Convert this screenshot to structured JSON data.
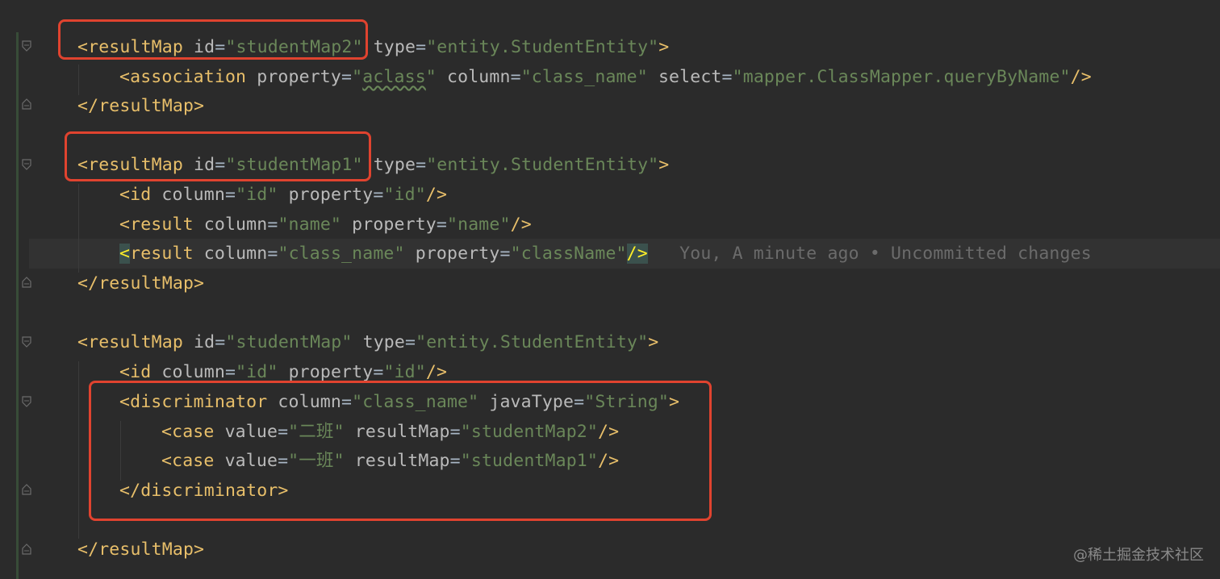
{
  "editor": {
    "lines": [
      {
        "parts": [
          [
            "t",
            "<resultMap "
          ],
          [
            "a",
            "id"
          ],
          [
            "p",
            "="
          ],
          [
            "v",
            "\"studentMap2\""
          ],
          [
            "p",
            " "
          ],
          [
            "a",
            "type"
          ],
          [
            "p",
            "="
          ],
          [
            "v",
            "\"entity.StudentEntity\""
          ],
          [
            "t",
            ">"
          ]
        ]
      },
      {
        "parts": [
          [
            "t",
            "<association "
          ],
          [
            "a",
            "property"
          ],
          [
            "p",
            "="
          ],
          [
            "v",
            "\""
          ],
          [
            "vs",
            "aclass"
          ],
          [
            "v",
            "\""
          ],
          [
            "p",
            " "
          ],
          [
            "a",
            "column"
          ],
          [
            "p",
            "="
          ],
          [
            "v",
            "\"class_name\""
          ],
          [
            "p",
            " "
          ],
          [
            "a",
            "select"
          ],
          [
            "p",
            "="
          ],
          [
            "v",
            "\"mapper.ClassMapper.queryByName\""
          ],
          [
            "t",
            "/>"
          ]
        ]
      },
      {
        "parts": [
          [
            "t",
            "</resultMap>"
          ]
        ]
      },
      {
        "parts": []
      },
      {
        "parts": [
          [
            "t",
            "<resultMap "
          ],
          [
            "a",
            "id"
          ],
          [
            "p",
            "="
          ],
          [
            "v",
            "\"studentMap1\""
          ],
          [
            "p",
            " "
          ],
          [
            "a",
            "type"
          ],
          [
            "p",
            "="
          ],
          [
            "v",
            "\"entity.StudentEntity\""
          ],
          [
            "t",
            ">"
          ]
        ]
      },
      {
        "parts": [
          [
            "t",
            "<id "
          ],
          [
            "a",
            "column"
          ],
          [
            "p",
            "="
          ],
          [
            "v",
            "\"id\""
          ],
          [
            "p",
            " "
          ],
          [
            "a",
            "property"
          ],
          [
            "p",
            "="
          ],
          [
            "v",
            "\"id\""
          ],
          [
            "t",
            "/>"
          ]
        ]
      },
      {
        "parts": [
          [
            "t",
            "<result "
          ],
          [
            "a",
            "column"
          ],
          [
            "p",
            "="
          ],
          [
            "v",
            "\"name\""
          ],
          [
            "p",
            " "
          ],
          [
            "a",
            "property"
          ],
          [
            "p",
            "="
          ],
          [
            "v",
            "\"name\""
          ],
          [
            "t",
            "/>"
          ]
        ]
      },
      {
        "parts": [
          [
            "h",
            "<"
          ],
          [
            "t",
            "result "
          ],
          [
            "a",
            "column"
          ],
          [
            "p",
            "="
          ],
          [
            "v",
            "\"class_name\""
          ],
          [
            "p",
            " "
          ],
          [
            "a",
            "property"
          ],
          [
            "p",
            "="
          ],
          [
            "v",
            "\"className\""
          ],
          [
            "h",
            "/>"
          ],
          [
            "b",
            "   You, A minute ago • Uncommitted changes"
          ]
        ]
      },
      {
        "parts": [
          [
            "t",
            "</resultMap>"
          ]
        ]
      },
      {
        "parts": []
      },
      {
        "parts": [
          [
            "t",
            "<resultMap "
          ],
          [
            "a",
            "id"
          ],
          [
            "p",
            "="
          ],
          [
            "v",
            "\"studentMap\""
          ],
          [
            "p",
            " "
          ],
          [
            "a",
            "type"
          ],
          [
            "p",
            "="
          ],
          [
            "v",
            "\"entity.StudentEntity\""
          ],
          [
            "t",
            ">"
          ]
        ]
      },
      {
        "parts": [
          [
            "t",
            "<id "
          ],
          [
            "a",
            "column"
          ],
          [
            "p",
            "="
          ],
          [
            "v",
            "\"id\""
          ],
          [
            "p",
            " "
          ],
          [
            "a",
            "property"
          ],
          [
            "p",
            "="
          ],
          [
            "v",
            "\"id\""
          ],
          [
            "t",
            "/>"
          ]
        ]
      },
      {
        "parts": [
          [
            "t",
            "<discriminator "
          ],
          [
            "a",
            "column"
          ],
          [
            "p",
            "="
          ],
          [
            "v",
            "\"class_name\""
          ],
          [
            "p",
            " "
          ],
          [
            "a",
            "javaType"
          ],
          [
            "p",
            "="
          ],
          [
            "v",
            "\"String\""
          ],
          [
            "t",
            ">"
          ]
        ]
      },
      {
        "parts": [
          [
            "t",
            "<case "
          ],
          [
            "a",
            "value"
          ],
          [
            "p",
            "="
          ],
          [
            "v",
            "\"二班\""
          ],
          [
            "p",
            " "
          ],
          [
            "a",
            "resultMap"
          ],
          [
            "p",
            "="
          ],
          [
            "v",
            "\"studentMap2\""
          ],
          [
            "t",
            "/>"
          ]
        ]
      },
      {
        "parts": [
          [
            "t",
            "<case "
          ],
          [
            "a",
            "value"
          ],
          [
            "p",
            "="
          ],
          [
            "v",
            "\"一班\""
          ],
          [
            "p",
            " "
          ],
          [
            "a",
            "resultMap"
          ],
          [
            "p",
            "="
          ],
          [
            "v",
            "\"studentMap1\""
          ],
          [
            "t",
            "/>"
          ]
        ]
      },
      {
        "parts": [
          [
            "t",
            "</discriminator>"
          ]
        ]
      },
      {
        "parts": []
      },
      {
        "parts": [
          [
            "t",
            "</resultMap>"
          ]
        ]
      }
    ]
  },
  "watermark": "@稀土掘金技术社区",
  "colors": {
    "background": "#2b2b2b",
    "tag": "#e8bf6a",
    "attribute": "#bababa",
    "string": "#6a8759",
    "annotation_box": "#e0432f"
  }
}
